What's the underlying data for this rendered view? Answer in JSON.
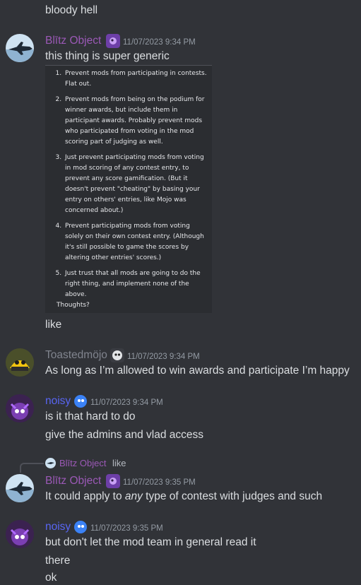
{
  "channel": {
    "top_message": "bloody hell",
    "messages": [
      {
        "author": "Blītz Object",
        "author_color": "#9b59b6",
        "timestamp": "11/07/2023 9:34 PM",
        "lines": [
          "this thing is super generic"
        ],
        "attachment": {
          "items": [
            "Prevent mods from participating in contests. Flat out.",
            "Prevent mods from being on the podium for winner awards, but include them in participant awards. Probably prevent mods who participated from voting in the mod scoring part of judging as well.",
            "Just prevent participating mods from voting in mod scoring of any contest entry, to prevent any score gamification. (But it doesn't prevent \"cheating\" by basing your entry on others' entries, like Mojo was concerned about.)",
            "Prevent participating mods from voting solely on their own contest entry. (Although it's still possible to game the scores by altering other entries' scores.)",
            "Just trust that all mods are going to do the right thing, and implement none of the above."
          ],
          "closing": "Thoughts?"
        },
        "after": "like"
      },
      {
        "author": "Toastedmöjo",
        "author_color": "#80848e",
        "timestamp": "11/07/2023 9:34 PM",
        "lines": [
          "As long as I’m allowed to win awards and participate I’m happy"
        ]
      },
      {
        "author": "noisy",
        "author_color": "#5865f2",
        "timestamp": "11/07/2023 9:34 PM",
        "lines": [
          "is it that hard to do",
          "give the admins and vlad access"
        ]
      },
      {
        "reply_to": {
          "author": "Blītz Object",
          "text": "like"
        },
        "author": "Blītz Object",
        "author_color": "#9b59b6",
        "timestamp": "11/07/2023 9:35 PM",
        "text_before": "It could apply to ",
        "text_em": "any",
        "text_after": " type of contest with judges and such"
      },
      {
        "author": "noisy",
        "author_color": "#5865f2",
        "timestamp": "11/07/2023 9:35 PM",
        "lines": [
          "but don't let the mod team in general read it",
          "there",
          "ok"
        ]
      }
    ]
  }
}
